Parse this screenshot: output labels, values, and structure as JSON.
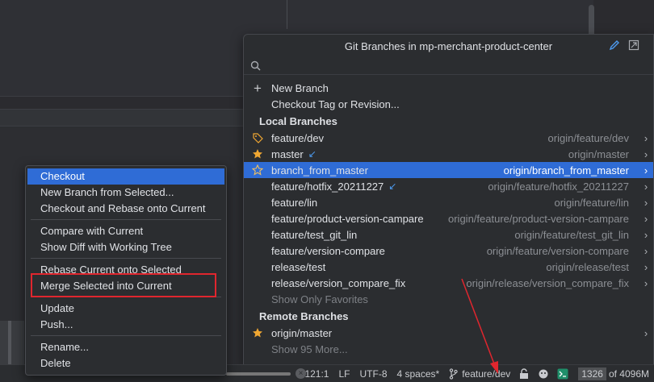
{
  "popup": {
    "title": "Git Branches in mp-merchant-product-center",
    "search_placeholder": "",
    "actions": [
      {
        "label": "New Branch",
        "icon": "plus-icon"
      },
      {
        "label": "Checkout Tag or Revision..."
      }
    ],
    "local_header": "Local Branches",
    "local_branches": [
      {
        "name": "feature/dev",
        "tracking": "origin/feature/dev",
        "icon": "tag-icon"
      },
      {
        "name": "master",
        "tracking": "origin/master",
        "icon": "star-filled-icon",
        "incoming": true
      },
      {
        "name": "branch_from_master",
        "tracking": "origin/branch_from_master",
        "icon": "star-outline-icon",
        "selected": true
      },
      {
        "name": "feature/hotfix_20211227",
        "tracking": "origin/feature/hotfix_20211227",
        "incoming": true
      },
      {
        "name": "feature/lin",
        "tracking": "origin/feature/lin"
      },
      {
        "name": "feature/product-version-campare",
        "tracking": "origin/feature/product-version-campare"
      },
      {
        "name": "feature/test_git_lin",
        "tracking": "origin/feature/test_git_lin"
      },
      {
        "name": "feature/version-compare",
        "tracking": "origin/feature/version-compare"
      },
      {
        "name": "release/test",
        "tracking": "origin/release/test"
      },
      {
        "name": "release/version_compare_fix",
        "tracking": "origin/release/version_compare_fix"
      }
    ],
    "show_only_favorites": "Show Only Favorites",
    "remote_header": "Remote Branches",
    "remote_branches": [
      {
        "name": "origin/master",
        "icon": "star-filled-icon"
      }
    ],
    "show_more": "Show 95 More..."
  },
  "context_menu": {
    "groups": [
      [
        "Checkout",
        "New Branch from Selected...",
        "Checkout and Rebase onto Current"
      ],
      [
        "Compare with Current",
        "Show Diff with Working Tree"
      ],
      [
        "Rebase Current onto Selected",
        "Merge Selected into Current"
      ],
      [
        "Update",
        "Push..."
      ],
      [
        "Rename...",
        "Delete"
      ]
    ],
    "selected": "Checkout",
    "highlighted": "Merge Selected into Current"
  },
  "statusbar": {
    "position": "121:1",
    "line_sep": "LF",
    "encoding": "UTF-8",
    "indent": "4 spaces*",
    "branch": "feature/dev",
    "memory_used": "1326",
    "memory_total": "of 4096M"
  },
  "colors": {
    "selection": "#2f6cd6",
    "star": "#f0a732",
    "annotation": "#e0262e"
  }
}
